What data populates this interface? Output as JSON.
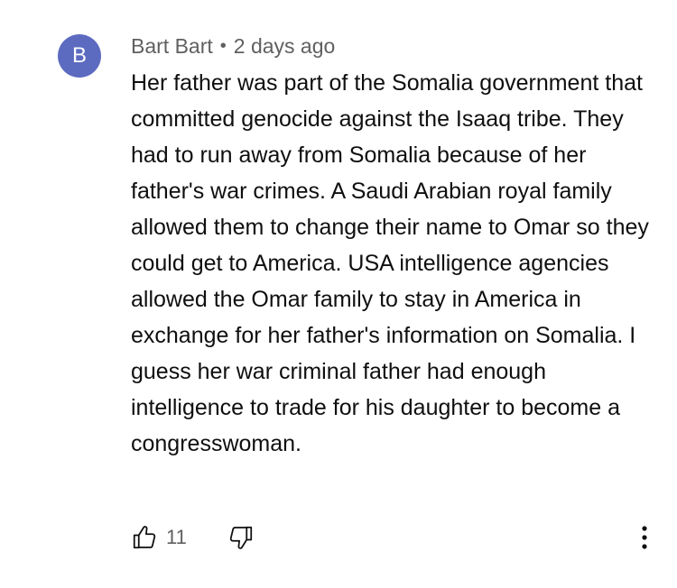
{
  "comment": {
    "avatar_letter": "B",
    "avatar_color": "#5c6bc0",
    "author": "Bart Bart",
    "separator": "•",
    "timestamp": "2 days ago",
    "text": "Her father was part of the Somalia government that committed genocide against the Isaaq tribe. They had to run away from Somalia because of her father's war crimes. A Saudi Arabian royal family allowed them to change their name to Omar so they could get to America. USA intelligence agencies allowed the Omar family to stay in America in exchange for her father's information on Somalia. I guess her war criminal father had enough intelligence to trade for his daughter to become a congresswoman.",
    "like_count": "11",
    "icons": {
      "like": "thumbs-up-icon",
      "dislike": "thumbs-down-icon",
      "more": "more-vertical-icon"
    }
  }
}
